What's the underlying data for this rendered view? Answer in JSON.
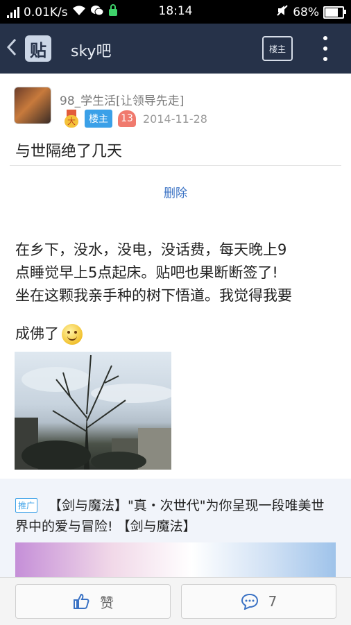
{
  "status_bar": {
    "network_speed": "0.01K/s",
    "time": "18:14",
    "battery": "68%",
    "battery_level": 0.68
  },
  "nav": {
    "back_icon": "chevron-left-icon",
    "logo_text": "贴",
    "title": "sky吧",
    "owner_button": "楼主",
    "more_icon": "vertical-dots-icon"
  },
  "post": {
    "author": "98_学生活[让领导先走]",
    "medal_text": "大",
    "owner_badge": "楼主",
    "level": "13",
    "date": "2014-11-28",
    "title": "与世隔绝了几天",
    "delete_label": "删除",
    "body_lines": [
      "在乡下，没水，没电，没话费，每天晚上9",
      "点睡觉早上5点起床。贴吧也果断断签了!",
      "坐在这颗我亲手种的树下悟道。我觉得我要",
      "成佛了"
    ]
  },
  "ad": {
    "label": "推广",
    "text": "【剑与魔法】\"真・次世代\"为你呈现一段唯美世界中的爱与冒险! 【剑与魔法】"
  },
  "bottom_bar": {
    "like_label": "赞",
    "reply_count": "7"
  }
}
